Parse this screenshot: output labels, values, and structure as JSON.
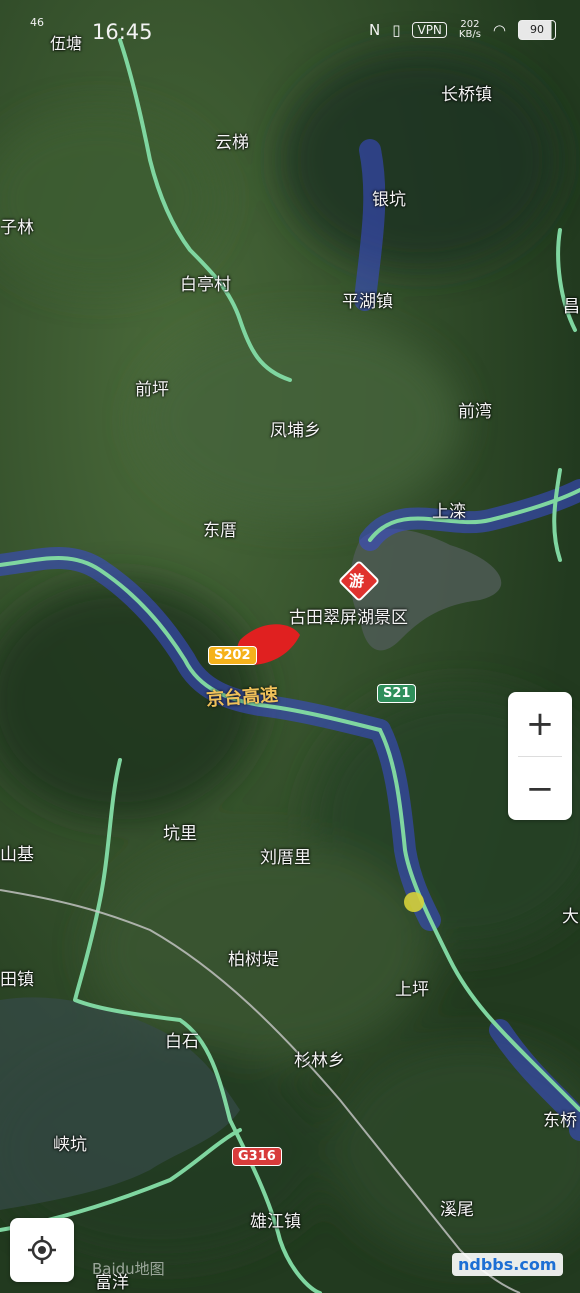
{
  "status_bar": {
    "time": "16:45",
    "signal": "46",
    "vpn": "VPN",
    "net_speed": "202",
    "net_speed_unit": "KB/s",
    "battery": "90",
    "carrier_overlay": "伍塘"
  },
  "places": [
    {
      "name": "长桥镇"
    },
    {
      "name": "云梯"
    },
    {
      "name": "银坑"
    },
    {
      "name": "子林"
    },
    {
      "name": "白亭村"
    },
    {
      "name": "平湖镇"
    },
    {
      "name": "前坪"
    },
    {
      "name": "凤埔乡"
    },
    {
      "name": "前湾"
    },
    {
      "name": "东厝"
    },
    {
      "name": "上滦"
    },
    {
      "name": "古田翠屏湖景区"
    },
    {
      "name": "坑里"
    },
    {
      "name": "刘厝里"
    },
    {
      "name": "山基"
    },
    {
      "name": "柏树堤"
    },
    {
      "name": "田镇"
    },
    {
      "name": "上坪"
    },
    {
      "name": "白石"
    },
    {
      "name": "杉林乡"
    },
    {
      "name": "东桥"
    },
    {
      "name": "峡坑"
    },
    {
      "name": "雄江镇"
    },
    {
      "name": "溪尾"
    },
    {
      "name": "富洋"
    },
    {
      "name": "大"
    },
    {
      "name": "昌"
    }
  ],
  "roads": {
    "s202": "S202",
    "s21": "S21",
    "g316": "G316",
    "expressway": "京台高速"
  },
  "poi": {
    "marker_text": "游"
  },
  "controls": {
    "zoom_in": "+",
    "zoom_out": "−"
  },
  "watermark": {
    "baidu": "Baidu地图",
    "site": "ndbbs.com"
  },
  "colors": {
    "terrain": "#2f4a2a",
    "road": "#7fd6a0",
    "traffic_heavy": "#e02020",
    "traffic_band": "#3a4bd6"
  }
}
